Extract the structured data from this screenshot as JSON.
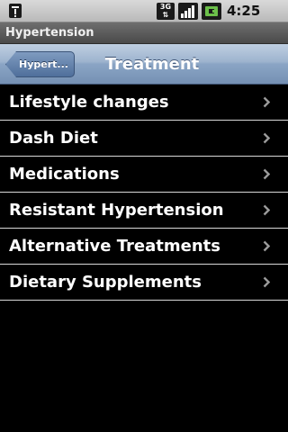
{
  "status_bar": {
    "network_label": "3G",
    "time": "4:25 PM",
    "icons": [
      "notification-icon",
      "network-3g-icon",
      "signal-icon",
      "battery-icon"
    ]
  },
  "app": {
    "title": "Hypertension"
  },
  "navbar": {
    "back_label": "Hypert...",
    "title": "Treatment"
  },
  "menu": {
    "items": [
      {
        "label": "Lifestyle changes"
      },
      {
        "label": "Dash Diet"
      },
      {
        "label": "Medications"
      },
      {
        "label": "Resistant Hypertension"
      },
      {
        "label": "Alternative Treatments"
      },
      {
        "label": "Dietary Supplements"
      }
    ]
  },
  "colors": {
    "navbar": "#8ba5c5",
    "back_button": "#5b7aa5",
    "background": "#000000",
    "divider": "#d8d8d8"
  }
}
